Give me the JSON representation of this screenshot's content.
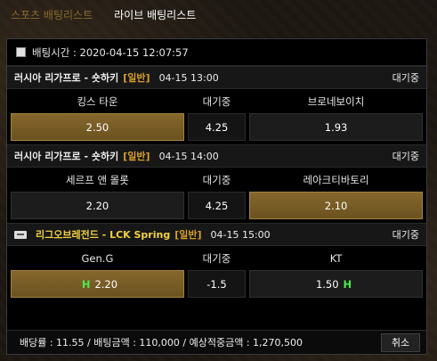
{
  "tabs": [
    {
      "label": "스포츠 배팅리스트",
      "active": true
    },
    {
      "label": "라이브 배팅리스트",
      "active": false
    }
  ],
  "bet_time": "배팅시간 : 2020-04-15 12:07:57",
  "games": [
    {
      "league": "러시아 리가프로 - 숏하키",
      "type": "[일반]",
      "time": "04-15 13:00",
      "status": "대기중",
      "home": "킹스 타운",
      "draw_label": "대기중",
      "away": "브로네보이치",
      "home_odds": "2.50",
      "draw_odds": "4.25",
      "away_odds": "1.93",
      "selected": "home"
    },
    {
      "league": "러시아 리가프로 - 숏하키",
      "type": "[일반]",
      "time": "04-15 14:00",
      "status": "대기중",
      "home": "세르프 앤 몰롯",
      "draw_label": "대기중",
      "away": "레아크티바토리",
      "home_odds": "2.20",
      "draw_odds": "4.25",
      "away_odds": "2.10",
      "selected": "away"
    },
    {
      "league": "리그오브레전드 - LCK Spring",
      "type": "[일반]",
      "time": "04-15 15:00",
      "status": "대기중",
      "home": "Gen.G",
      "draw_label": "대기중",
      "away": "KT",
      "home_odds": "2.20",
      "draw_odds": "-1.5",
      "away_odds": "1.50",
      "handicap_marker": "H",
      "selected": "home"
    }
  ],
  "summary": "배당률 : 11.55 / 배팅금액 : 110,000 / 예상적중금액 : 1,270,500",
  "cancel_label": "취소",
  "colors": {
    "accent_gold": "#8a6a2c",
    "selected_fill": "#7a5d26",
    "type_label": "#d8a028",
    "lol_league": "#f1d141",
    "handicap_marker": "#4de84d"
  }
}
